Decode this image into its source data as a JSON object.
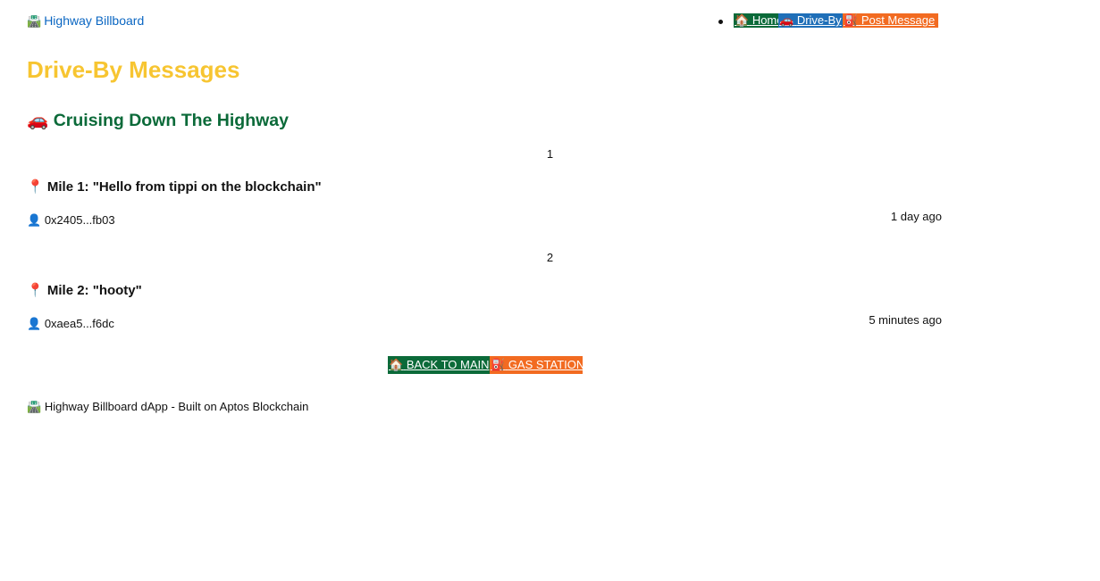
{
  "header": {
    "brand_icon": "🛣️",
    "brand_label": "Highway Billboard",
    "nav": [
      {
        "icon": "🏠",
        "label": "Home"
      },
      {
        "icon": "🚗",
        "label": "Drive-By"
      },
      {
        "icon": "⛽",
        "label": "Post Message"
      }
    ]
  },
  "page": {
    "title": "Drive-By Messages",
    "section_icon": "🚗",
    "section_title": "Cruising Down The Highway"
  },
  "messages": [
    {
      "index": "1",
      "pin_icon": "📍",
      "title": "Mile 1: \"Hello from tippi on the blockchain\"",
      "author_icon": "👤",
      "author": "0x2405...fb03",
      "time": "1 day ago"
    },
    {
      "index": "2",
      "pin_icon": "📍",
      "title": "Mile 2: \"hooty\"",
      "author_icon": "👤",
      "author": "0xaea5...f6dc",
      "time": "5 minutes ago"
    }
  ],
  "actions": {
    "back_icon": "🏠",
    "back_label": "BACK TO MAIN",
    "gas_icon": "⛽",
    "gas_label": "GAS STATION"
  },
  "footer": {
    "icon": "🛣️",
    "text": "Highway Billboard dApp - Built on Aptos Blockchain"
  },
  "colors": {
    "title_yellow": "#f7c531",
    "green": "#0b6a39",
    "blue": "#1f6fb8",
    "orange": "#f26b21",
    "link_blue": "#0a66c2"
  }
}
